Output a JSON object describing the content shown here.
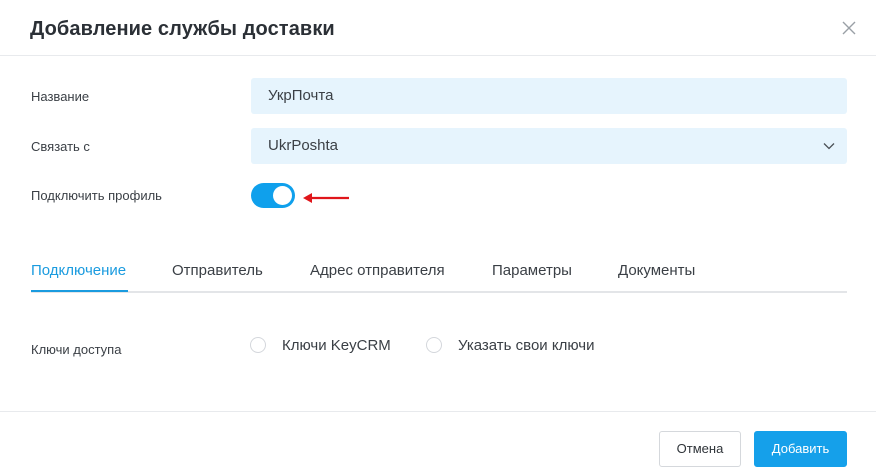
{
  "modal": {
    "title": "Добавление службы доставки"
  },
  "form": {
    "name_label": "Название",
    "name_value": "УкрПочта",
    "link_label": "Связать с",
    "link_value": "UkrPoshta",
    "connect_label": "Подключить профиль",
    "connect_enabled": true
  },
  "tabs": [
    {
      "label": "Подключение",
      "active": true
    },
    {
      "label": "Отправитель",
      "active": false
    },
    {
      "label": "Адрес отправителя",
      "active": false
    },
    {
      "label": "Параметры",
      "active": false
    },
    {
      "label": "Документы",
      "active": false
    }
  ],
  "access": {
    "label": "Ключи доступа",
    "options": [
      {
        "label": "Ключи KeyCRM",
        "selected": false
      },
      {
        "label": "Указать свои ключи",
        "selected": false
      }
    ]
  },
  "footer": {
    "cancel_label": "Отмена",
    "add_label": "Добавить"
  },
  "colors": {
    "accent": "#15a0ea",
    "input_bg": "#e6f4fd",
    "annotation_arrow": "#e0161b"
  }
}
